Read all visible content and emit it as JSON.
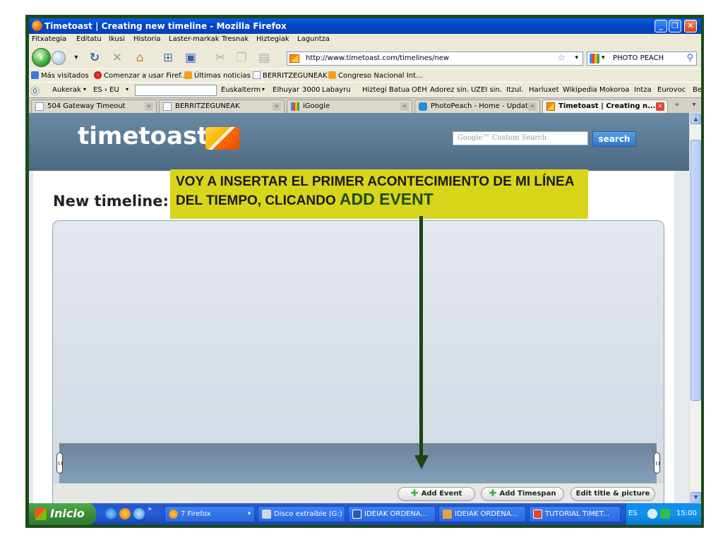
{
  "window": {
    "title": "Timetoast | Creating new timeline - Mozilla Firefox"
  },
  "menu": [
    "Fitxategia",
    "Editatu",
    "Ikusi",
    "Historia",
    "Laster-markak",
    "Tresnak",
    "Hiztegiak",
    "Laguntza"
  ],
  "navbar": {
    "url": "http://www.timetoast.com/timelines/new",
    "search_label": "PHOTO PEACH"
  },
  "bookmarks": [
    "Más visitados",
    "Comenzar a usar Firef...",
    "Últimas noticias",
    "BERRITZEGUNEAK",
    "Congreso Nacional Int..."
  ],
  "addonbar": {
    "items": [
      "Aukerak",
      "ES › EU",
      "Euskalterm",
      "Elhuyar",
      "3000",
      "Labayru",
      "Hiztegi Batua",
      "OEH",
      "Adorez sin.",
      "UZEI sin.",
      "Itzul.",
      "Harluxet",
      "Wikipedia",
      "Mokoroa",
      "Intza",
      "Eurovoc",
      "Be"
    ]
  },
  "tabs": [
    {
      "label": "504 Gateway Timeout",
      "active": false
    },
    {
      "label": "BERRITZEGUNEAK",
      "active": false
    },
    {
      "label": "iGoogle",
      "active": false
    },
    {
      "label": "PhotoPeach - Home - Updat...",
      "active": false
    },
    {
      "label": "Timetoast | Creating n...",
      "active": true
    }
  ],
  "site": {
    "logo": "timetoast",
    "google_label": "Google™ Custom Search",
    "search_button": "search"
  },
  "page": {
    "title": "New timeline:",
    "buttons": {
      "add_event": "Add Event",
      "add_timespan": "Add Timespan",
      "edit_title": "Edit title & picture"
    }
  },
  "callout": {
    "text": "VOY A INSERTAR EL PRIMER ACONTECIMIENTO DE MI LÍNEA DEL TIEMPO, CLICANDO",
    "highlight": "ADD EVENT"
  },
  "taskbar": {
    "start": "Inicio",
    "tasks": [
      "7 Firefox",
      "Disco extraíble (G:)",
      "IDEIAK ORDENA...",
      "IDEIAK ORDENA...",
      "TUTORIAL TIMET..."
    ],
    "lang": "ES",
    "clock": "15:00"
  },
  "colors": {
    "callout_bg": "#d8d51a",
    "arrow": "#1c4416",
    "header": "#5a7891"
  }
}
